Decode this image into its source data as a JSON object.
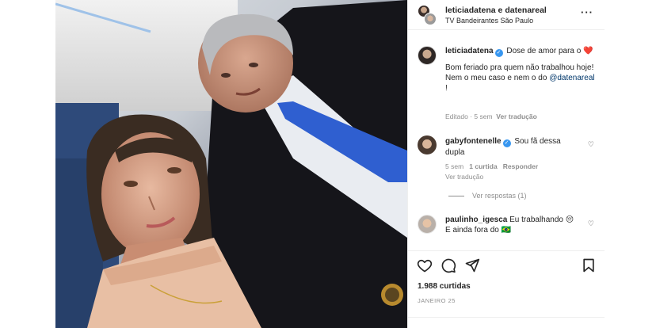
{
  "post": {
    "header": {
      "title_user1": "leticiadatena",
      "title_connector": " e ",
      "title_user2": "datenareal",
      "location": "TV Bandeirantes São Paulo",
      "more_icon": "more-horizontal-icon"
    },
    "caption": {
      "username": "leticiadatena",
      "text_part1": "Dose de amor para o",
      "heart": "❤️",
      "text_part2": "Bom feriado pra quem não trabalhou hoje! Nem o meu caso e nem o do",
      "mention": "@datenareal",
      "text_part3": " !",
      "edited": "Editado",
      "time": "5 sem",
      "see_translation": "Ver tradução"
    },
    "comments": [
      {
        "username": "gabyfontenelle",
        "verified": true,
        "text": "Sou fã dessa dupla",
        "time": "5 sem",
        "likes": "1 curtida",
        "reply": "Responder",
        "see_translation": "Ver tradução",
        "view_replies": "Ver respostas (1)"
      },
      {
        "username": "paulinho_igesca",
        "text": "Eu trabalhando",
        "emoji": "😔",
        "text2": "E ainda fora do",
        "flag": "🇧🇷"
      }
    ],
    "likes": "1.988 curtidas",
    "date": "JANEIRO 25",
    "colors": {
      "accent_blue": "#3897f0",
      "heart_red": "#ed4956",
      "muted": "#8e8e8e"
    }
  }
}
